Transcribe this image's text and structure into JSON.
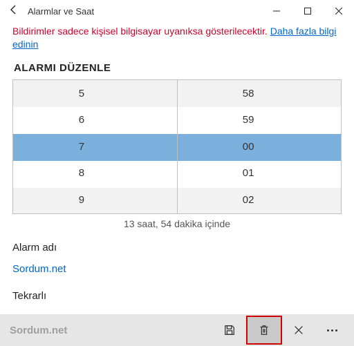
{
  "window": {
    "title": "Alarmlar ve Saat"
  },
  "notice": {
    "text": "Bildirimler sadece kişisel bilgisayar uyanıksa gösterilecektir. ",
    "link": "Daha fazla bilgi edinin"
  },
  "heading": "ALARMI DÜZENLE",
  "picker": {
    "hours": [
      "5",
      "6",
      "7",
      "8",
      "9"
    ],
    "minutes": [
      "58",
      "59",
      "00",
      "01",
      "02"
    ],
    "selected_hour": "7",
    "selected_minute": "00"
  },
  "countdown": "13 saat, 54 dakika içinde",
  "alarm_name": {
    "label": "Alarm adı",
    "value": "Sordum.net"
  },
  "repeat": {
    "label": "Tekrarlı"
  },
  "cmdbar": {
    "brand": "Sordum.net"
  }
}
